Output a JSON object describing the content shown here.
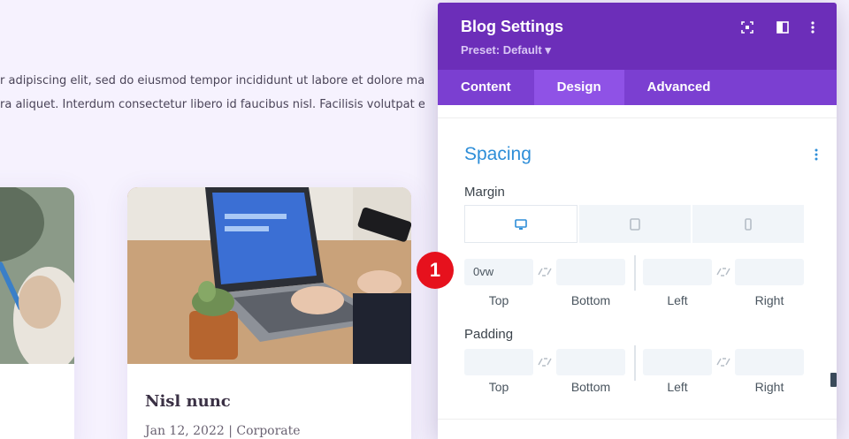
{
  "background": {
    "text_lines": [
      "r adipiscing elit, sed do eiusmod tempor incididunt ut labore et dolore magna",
      "ra aliquet. Interdum consectetur libero id faucibus nisl. Facilisis volutpat est"
    ],
    "card": {
      "title": "Nisl nunc",
      "meta": "Jan 12, 2022 | Corporate"
    }
  },
  "panel": {
    "title": "Blog Settings",
    "preset": "Preset: Default ▾",
    "header_icons": [
      "expand-icon",
      "split-view-icon",
      "more-vertical-icon"
    ],
    "tabs": [
      {
        "label": "Content",
        "active": false
      },
      {
        "label": "Design",
        "active": true
      },
      {
        "label": "Advanced",
        "active": false
      }
    ],
    "section": {
      "title": "Spacing",
      "margin_label": "Margin",
      "padding_label": "Padding",
      "devices": [
        "desktop-icon",
        "tablet-icon",
        "phone-icon"
      ],
      "margin": {
        "top": "0vw",
        "bottom": "",
        "left": "",
        "right": ""
      },
      "padding": {
        "top": "",
        "bottom": "",
        "left": "",
        "right": ""
      },
      "labels": {
        "top": "Top",
        "bottom": "Bottom",
        "left": "Left",
        "right": "Right"
      }
    }
  },
  "badge": "1",
  "colors": {
    "header": "#6c2eb9",
    "tabs": "#7b3fd1",
    "active_tab": "#8f52e6",
    "section_title": "#2e8ed8",
    "badge": "#e6111d"
  }
}
